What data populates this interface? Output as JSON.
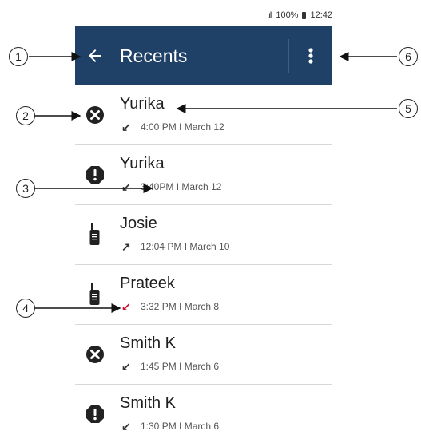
{
  "status": {
    "signal": ".ıll",
    "battery": "100%",
    "time": "12:42"
  },
  "appbar": {
    "title": "Recents",
    "back_icon": "arrow-left-icon",
    "menu_icon": "more-vertical-icon",
    "color": "#1f4167"
  },
  "rows": [
    {
      "name": "Yurika",
      "icon": "missed-x-icon",
      "direction_icon": "incoming-call-icon",
      "direction": "↙",
      "time": "4:00 PM I March 12"
    },
    {
      "name": "Yurika",
      "icon": "alert-exclamation-icon",
      "direction_icon": "incoming-outgoing-icon",
      "direction": "↙",
      "time": "3:40PM I March 12"
    },
    {
      "name": "Josie",
      "icon": "radio-device-icon",
      "direction_icon": "outgoing-call-icon",
      "direction": "↗",
      "time": "12:04 PM I March 10"
    },
    {
      "name": "Prateek",
      "icon": "radio-device-icon",
      "direction_icon": "missed-call-icon",
      "direction": "↙",
      "time": "3:32 PM I March 8"
    },
    {
      "name": "Smith K",
      "icon": "missed-x-icon",
      "direction_icon": "incoming-call-icon",
      "direction": "↙",
      "time": "1:45 PM I March 6"
    },
    {
      "name": "Smith K",
      "icon": "alert-exclamation-icon",
      "direction_icon": "incoming-call-icon",
      "direction": "↙",
      "time": "1:30 PM I March 6"
    }
  ],
  "callouts": [
    "1",
    "2",
    "3",
    "4",
    "5",
    "6"
  ]
}
